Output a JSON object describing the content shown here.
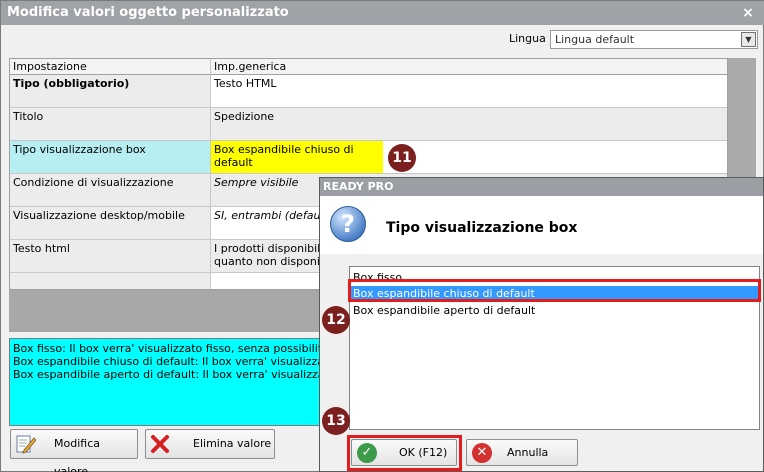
{
  "window": {
    "title": "Modifica valori oggetto personalizzato",
    "close_icon": "×"
  },
  "language": {
    "label": "Lingua :",
    "value": "Lingua default",
    "arrow": "▼"
  },
  "grid": {
    "headers": [
      "Impostazione",
      "Imp.generica"
    ],
    "rows": [
      {
        "setting": "Tipo (obbligatorio)",
        "value": "Testo HTML"
      },
      {
        "setting": "Titolo",
        "value": "Spedizione"
      },
      {
        "setting": "Tipo visualizzazione box",
        "value": "Box espandibile chiuso di default"
      },
      {
        "setting": "Condizione di visualizzazione",
        "value": "Sempre visibile"
      },
      {
        "setting": "Visualizzazione desktop/mobile",
        "value": "SI, entrambi (default)"
      },
      {
        "setting": "Testo html",
        "value": "I prodotti disponibili su",
        "value2": "quanto non disponibili p"
      }
    ]
  },
  "description": [
    "Box fisso: Il box verra' visualizzato fisso, senza possibilita' di esp",
    "Box espandibile chiuso di default: Il box verra' visualizzato chius",
    "Box espandibile aperto di default: Il box verra' visualizzato apert"
  ],
  "buttons": {
    "edit": "Modifica valore",
    "delete": "Elimina valore"
  },
  "dialog": {
    "title": "READY PRO",
    "heading": "Tipo visualizzazione box",
    "question_icon": "?",
    "options": [
      "Box fisso",
      "Box espandibile chiuso di default",
      "Box espandibile aperto di default"
    ],
    "selected_index": 1,
    "ok_label": "OK (F12)",
    "cancel_label": "Annulla (ESC)"
  },
  "badges": [
    "11",
    "12",
    "13"
  ],
  "colors": {
    "selected_row_left": "#b6eef2",
    "selected_row_right": "#ffff00",
    "description_bg": "#00ffff",
    "highlight_border": "#e41c1c",
    "badge": "#7b1f1f",
    "list_selection": "#3399ff"
  }
}
